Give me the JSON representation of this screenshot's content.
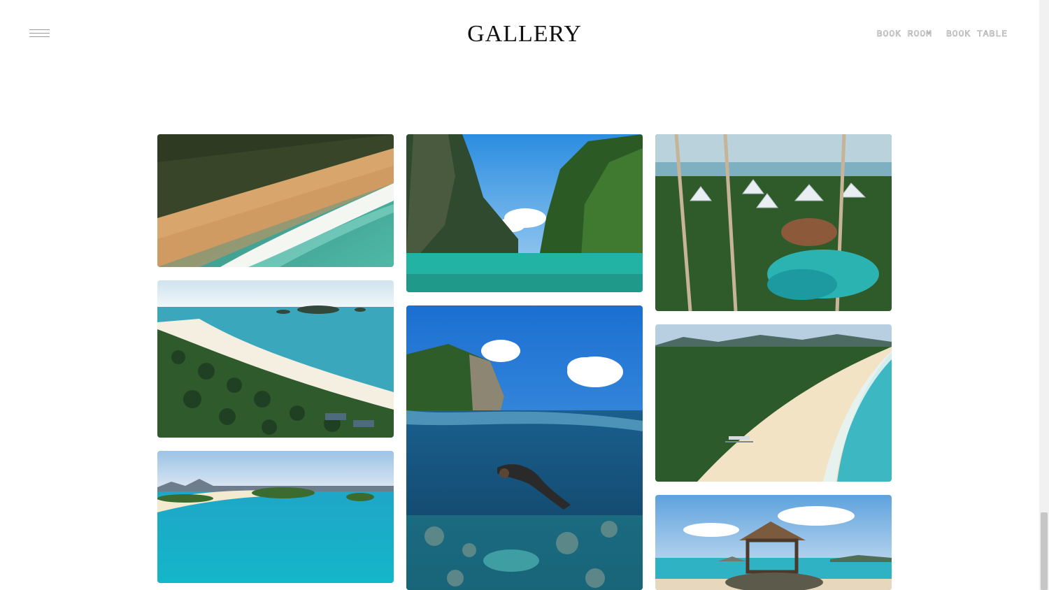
{
  "header": {
    "title": "GALLERY",
    "nav": [
      {
        "label": "BOOK ROOM"
      },
      {
        "label": "BOOK TABLE"
      }
    ]
  },
  "gallery": [
    {
      "name": "aerial-beach-waves-photo"
    },
    {
      "name": "lagoon-cliffs-photo"
    },
    {
      "name": "resort-tents-pool-photo"
    },
    {
      "name": "palm-beach-islands-photo"
    },
    {
      "name": "snorkeler-underwater-photo"
    },
    {
      "name": "long-white-beach-photo"
    },
    {
      "name": "turquoise-bay-photo"
    },
    {
      "name": "beach-gazebo-photo"
    }
  ]
}
